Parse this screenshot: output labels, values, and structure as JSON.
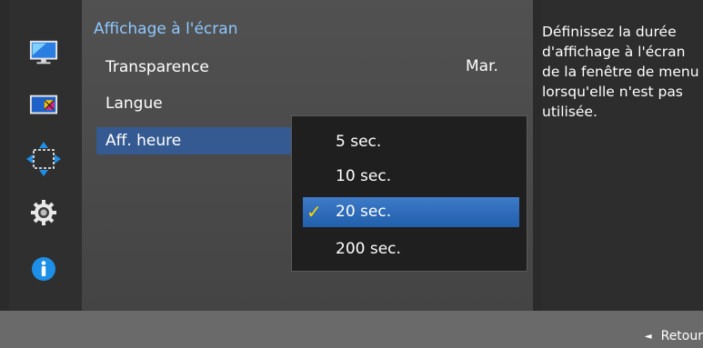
{
  "main": {
    "title": "Affichage à l'écran",
    "items": [
      {
        "label": "Transparence",
        "value": "Mar."
      },
      {
        "label": "Langue"
      },
      {
        "label": "Aff. heure"
      }
    ]
  },
  "dropdown": {
    "options": [
      "5 sec.",
      "10 sec.",
      "20 sec.",
      "200 sec."
    ],
    "selected": "20 sec."
  },
  "help": {
    "text": "Définissez la durée d'affichage à l'écran de la fenêtre de menu lorsqu'elle n'est pas utilisée."
  },
  "footer": {
    "back_label": "Retour"
  },
  "colors": {
    "title": "#8ec8ff",
    "selected_row": "#355a91",
    "selected_option": "#2f6bb8",
    "check": "#ffd700"
  },
  "sidebar_icons": [
    "monitor-picture-icon",
    "color-icon",
    "position-arrows-icon",
    "gear-icon",
    "info-icon"
  ]
}
